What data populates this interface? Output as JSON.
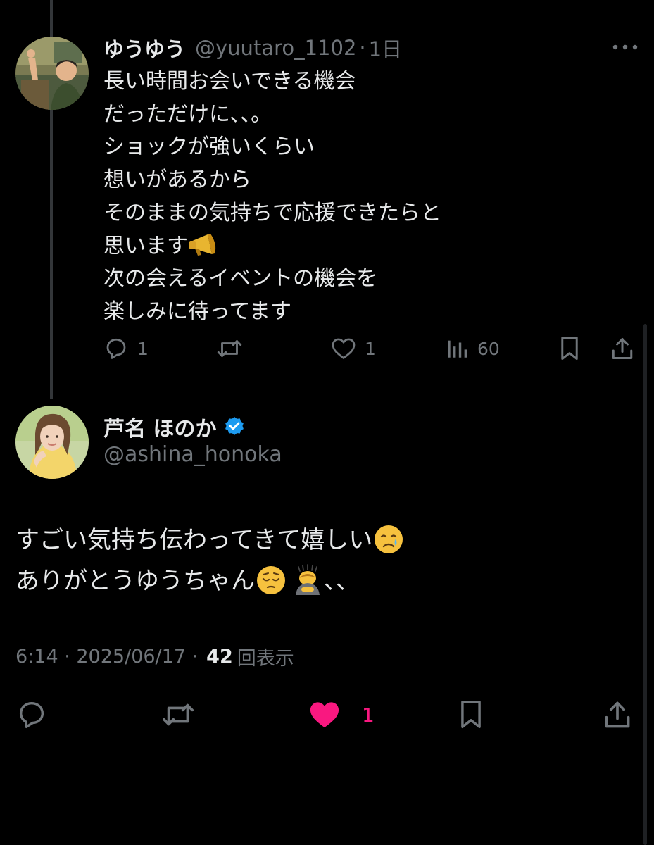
{
  "reply": {
    "name": "ゆうゆう",
    "handle": "@yuutaro_1102",
    "separator": "·",
    "time": "1日",
    "lines": [
      "長い時間お会いできる機会",
      "だっただけに、、。",
      "ショックが強いくらい",
      "想いがあるから",
      "そのままの気持ちで応援できたらと",
      "思います",
      "次の会えるイベントの機会を",
      "楽しみに待ってます"
    ],
    "actions": {
      "reply_count": "1",
      "like_count": "1",
      "view_count": "60"
    },
    "icons": [
      "more-icon",
      "reply-icon",
      "retweet-icon",
      "like-icon",
      "views-icon",
      "bookmark-icon",
      "share-icon",
      "megaphone-emoji"
    ]
  },
  "main": {
    "name": "芦名 ほのか",
    "handle": "@ashina_honoka",
    "verified": true,
    "lines": [
      "すごい気持ち伝わってきて嬉しい",
      "ありがとうゆうちゃん"
    ],
    "line2_suffix": "、、",
    "emojis": [
      "crying-face",
      "pensive-face",
      "person-bowing"
    ],
    "timestamp": "6:14 · 2025/06/17 ·",
    "views": "42",
    "views_label": "回表示",
    "like_count": "1",
    "liked": true,
    "colors": {
      "like_active": "#f91880",
      "verified": "#1d9bf0",
      "muted": "#71767b",
      "text": "#e7e9ea",
      "background": "#000000"
    }
  }
}
